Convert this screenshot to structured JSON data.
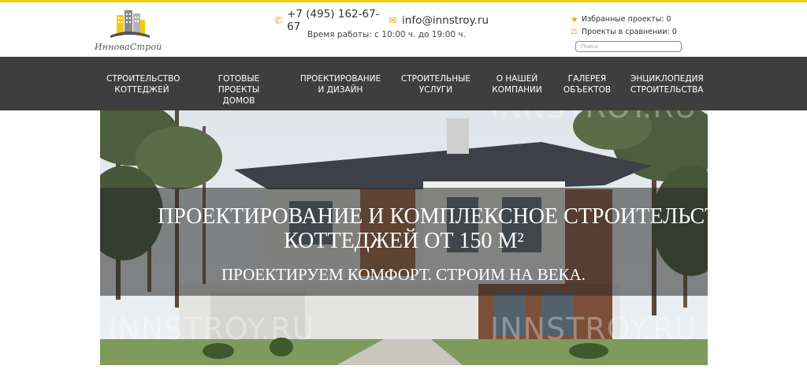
{
  "header": {
    "logo_text": "ИнноваСтрой",
    "phone": "+7 (495) 162-67-67",
    "email": "info@innstroy.ru",
    "hours": "Время работы: с 10:00 ч. до 19:00 ч.",
    "favorites": "Избранные проекты: 0",
    "compare": "Проекты в сравнении: 0",
    "search_placeholder": "Поиск"
  },
  "nav": {
    "items": [
      {
        "label": "СТРОИТЕЛЬСТВО\nКОТТЕДЖЕЙ"
      },
      {
        "label": "ГОТОВЫЕ ПРОЕКТЫ\nДОМОВ"
      },
      {
        "label": "ПРОЕКТИРОВАНИЕ\nИ ДИЗАЙН"
      },
      {
        "label": "СТРОИТЕЛЬНЫЕ\nУСЛУГИ"
      },
      {
        "label": "О НАШЕЙ\nКОМПАНИИ"
      },
      {
        "label": "ГАЛЕРЕЯ\nОБЪЕКТОВ"
      },
      {
        "label": "ЭНЦИКЛОПЕДИЯ\nСТРОИТЕЛЬСТВА"
      }
    ]
  },
  "hero": {
    "title_line1": "ПРОЕКТИРОВАНИЕ И КОМПЛЕКСНОЕ СТРОИТЕЛЬСТВО",
    "title_line2": "КОТТЕДЖЕЙ ОТ 150 М²",
    "subtitle": "ПРОЕКТИРУЕМ КОМФОРТ. СТРОИМ НА ВЕКА.",
    "watermark": "INNSTROY.RU"
  },
  "colors": {
    "accent": "#f2cc0f",
    "nav_bg": "#3e3e3e"
  }
}
